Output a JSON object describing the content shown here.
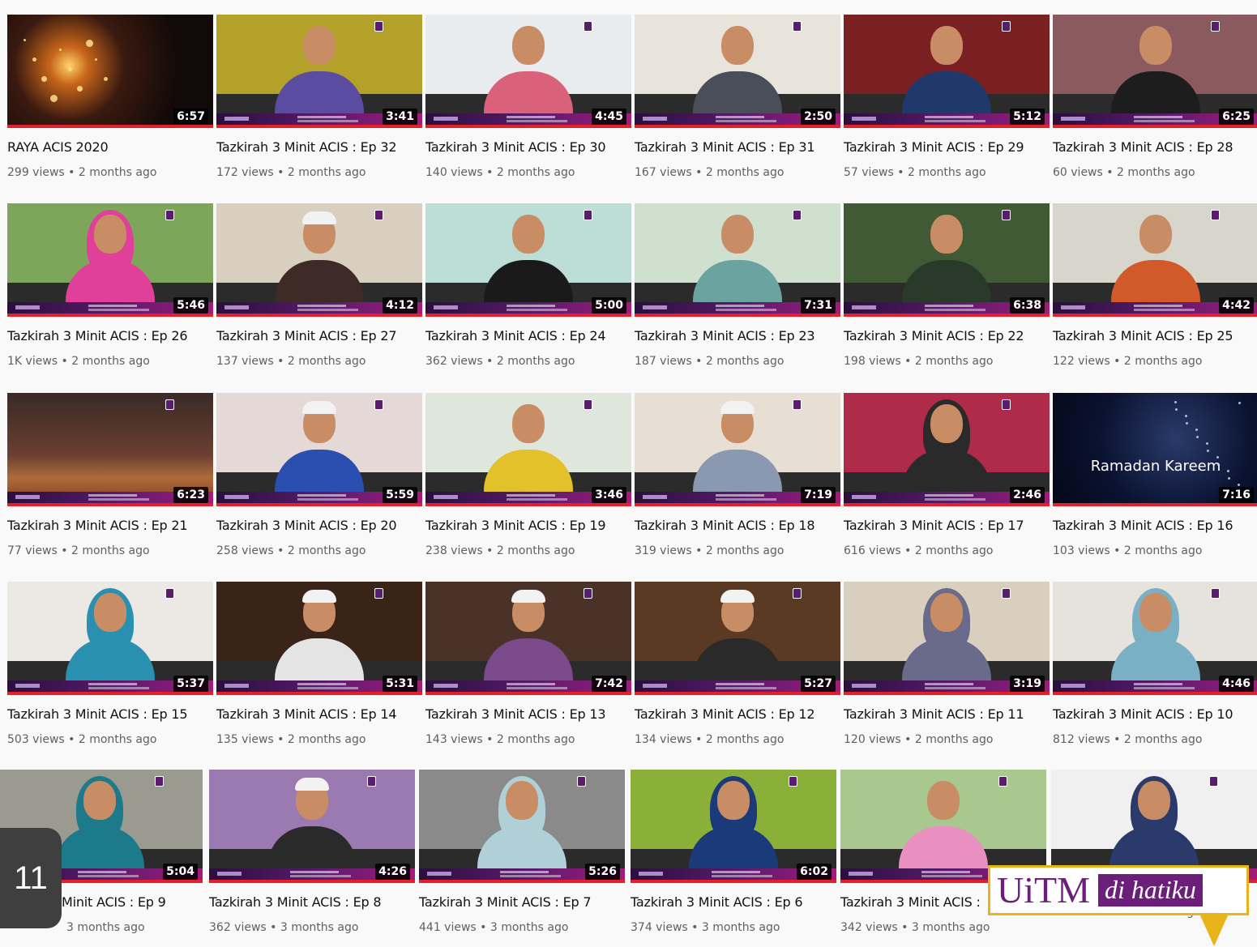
{
  "page_number": "11",
  "watermark": {
    "main": "UiTM",
    "sub": "di hatiku",
    "border_color": "#e8b41a",
    "brand_color": "#6b1f7a"
  },
  "videos": [
    {
      "title": "RAYA ACIS 2020",
      "meta": "299 views • 2 months ago",
      "duration": "6:57",
      "scene": "eid"
    },
    {
      "title": "Tazkirah 3 Minit ACIS : Ep 32",
      "meta": "172 views • 2 months ago",
      "duration": "3:41",
      "scene": "man",
      "wall": "#b3a12a",
      "shirt": "#5a4ca0"
    },
    {
      "title": "Tazkirah 3 Minit ACIS : Ep 30",
      "meta": "140 views • 2 months ago",
      "duration": "4:45",
      "scene": "man",
      "wall": "#e9ecee",
      "shirt": "#d9627a"
    },
    {
      "title": "Tazkirah 3 Minit ACIS : Ep 31",
      "meta": "167 views • 2 months ago",
      "duration": "2:50",
      "scene": "man",
      "wall": "#e8e4dc",
      "shirt": "#4a4e58"
    },
    {
      "title": "Tazkirah 3 Minit ACIS : Ep 29",
      "meta": "57 views • 2 months ago",
      "duration": "5:12",
      "scene": "man",
      "wall": "#7a1f22",
      "shirt": "#1f3a6a"
    },
    {
      "title": "Tazkirah 3 Minit ACIS : Ep 28",
      "meta": "60 views • 2 months ago",
      "duration": "6:25",
      "scene": "man",
      "wall": "#8a5a5e",
      "shirt": "#1d1d1d"
    },
    {
      "title": "Tazkirah 3 Minit ACIS : Ep 26",
      "meta": "1K views • 2 months ago",
      "duration": "5:46",
      "scene": "hijab",
      "wall": "#7ea65a",
      "shirt": "#e0409a"
    },
    {
      "title": "Tazkirah 3 Minit ACIS : Ep 27",
      "meta": "137 views • 2 months ago",
      "duration": "4:12",
      "scene": "cap",
      "wall": "#d9cfc0",
      "shirt": "#3e2a26"
    },
    {
      "title": "Tazkirah 3 Minit ACIS : Ep 24",
      "meta": "362 views • 2 months ago",
      "duration": "5:00",
      "scene": "man",
      "wall": "#bcded6",
      "shirt": "#1a1a1a"
    },
    {
      "title": "Tazkirah 3 Minit ACIS : Ep 23",
      "meta": "187 views • 2 months ago",
      "duration": "7:31",
      "scene": "man",
      "wall": "#cfe0cf",
      "shirt": "#6aa3a0"
    },
    {
      "title": "Tazkirah 3 Minit ACIS : Ep 22",
      "meta": "198 views • 2 months ago",
      "duration": "6:38",
      "scene": "man",
      "wall": "#3f5a35",
      "shirt": "#2a3a2a"
    },
    {
      "title": "Tazkirah 3 Minit ACIS : Ep 25",
      "meta": "122 views • 2 months ago",
      "duration": "4:42",
      "scene": "man",
      "wall": "#d8d5cc",
      "shirt": "#d25a2a"
    },
    {
      "title": "Tazkirah 3 Minit ACIS : Ep 21",
      "meta": "77 views • 2 months ago",
      "duration": "6:23",
      "scene": "ramadhan"
    },
    {
      "title": "Tazkirah 3 Minit ACIS : Ep 20",
      "meta": "258 views • 2 months ago",
      "duration": "5:59",
      "scene": "cap",
      "wall": "#e4d9d6",
      "shirt": "#2a4fb0"
    },
    {
      "title": "Tazkirah 3 Minit ACIS : Ep 19",
      "meta": "238 views • 2 months ago",
      "duration": "3:46",
      "scene": "man",
      "wall": "#dfe6dc",
      "shirt": "#e4c02a"
    },
    {
      "title": "Tazkirah 3 Minit ACIS : Ep 18",
      "meta": "319 views • 2 months ago",
      "duration": "7:19",
      "scene": "cap",
      "wall": "#e8dfd4",
      "shirt": "#8a98b0"
    },
    {
      "title": "Tazkirah 3 Minit ACIS : Ep 17",
      "meta": "616 views • 2 months ago",
      "duration": "2:46",
      "scene": "hijab",
      "wall": "#b02a4a",
      "shirt": "#2a2a2a"
    },
    {
      "title": "Tazkirah 3 Minit ACIS : Ep 16",
      "meta": "103 views • 2 months ago",
      "duration": "7:16",
      "scene": "kareem",
      "caption": "Ramadan Kareem"
    },
    {
      "title": "Tazkirah 3 Minit ACIS : Ep 15",
      "meta": "503 views • 2 months ago",
      "duration": "5:37",
      "scene": "hijab",
      "wall": "#ece8e4",
      "shirt": "#2a90b0"
    },
    {
      "title": "Tazkirah 3 Minit ACIS : Ep 14",
      "meta": "135 views • 2 months ago",
      "duration": "5:31",
      "scene": "cap",
      "wall": "#3a2418",
      "shirt": "#e4e4e4"
    },
    {
      "title": "Tazkirah 3 Minit ACIS : Ep 13",
      "meta": "143 views • 2 months ago",
      "duration": "7:42",
      "scene": "cap",
      "wall": "#4a3228",
      "shirt": "#7a4a8a"
    },
    {
      "title": "Tazkirah 3 Minit ACIS : Ep 12",
      "meta": "134 views • 2 months ago",
      "duration": "5:27",
      "scene": "cap",
      "wall": "#5a3a22",
      "shirt": "#2a2a2a"
    },
    {
      "title": "Tazkirah 3 Minit ACIS : Ep 11",
      "meta": "120 views • 2 months ago",
      "duration": "3:19",
      "scene": "hijab",
      "wall": "#d9cfbf",
      "shirt": "#6a6a8a"
    },
    {
      "title": "Tazkirah 3 Minit ACIS : Ep 10",
      "meta": "812 views • 2 months ago",
      "duration": "4:46",
      "scene": "hijab",
      "wall": "#e6e2dc",
      "shirt": "#7ab0c4"
    },
    {
      "title": "Minit ACIS : Ep 9",
      "meta": "3 months ago",
      "duration": "5:04",
      "scene": "hijab",
      "wall": "#9a9a90",
      "shirt": "#1d7a8a"
    },
    {
      "title": "Tazkirah 3 Minit ACIS : Ep 8",
      "meta": "362 views • 3 months ago",
      "duration": "4:26",
      "scene": "cap",
      "wall": "#9a7ab0",
      "shirt": "#2a2a2a"
    },
    {
      "title": "Tazkirah 3 Minit ACIS : Ep 7",
      "meta": "441 views • 3 months ago",
      "duration": "5:26",
      "scene": "hijab",
      "wall": "#8a8a8a",
      "shirt": "#b0d0d8"
    },
    {
      "title": "Tazkirah 3 Minit ACIS : Ep 6",
      "meta": "374 views • 3 months ago",
      "duration": "6:02",
      "scene": "hijab",
      "wall": "#8ab03a",
      "shirt": "#1a3a7a"
    },
    {
      "title": "Tazkirah 3 Minit ACIS :",
      "meta": "342 views • 3 months ago",
      "duration": "",
      "scene": "man",
      "wall": "#a8c890",
      "shirt": "#e890c0"
    },
    {
      "title": "",
      "meta": "204 views • 3 months ago",
      "duration": "",
      "scene": "hijab",
      "wall": "#f0f0f0",
      "shirt": "#2a3a6a"
    }
  ]
}
